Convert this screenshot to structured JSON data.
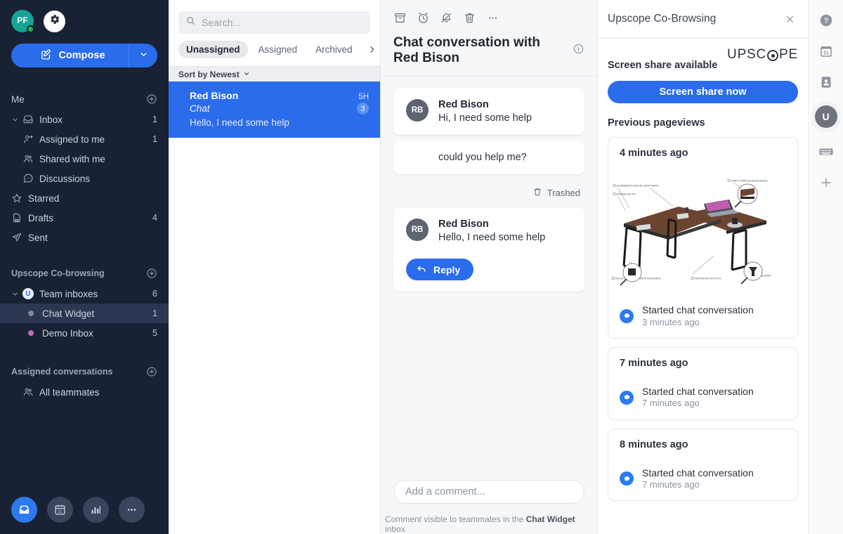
{
  "sidebar": {
    "me_avatar_initials": "PF",
    "compose_label": "Compose",
    "sections": [
      {
        "title": "Me"
      },
      {
        "title": "Upscope Co-browsing"
      },
      {
        "title": "Assigned conversations"
      }
    ],
    "me_items": [
      {
        "label": "Inbox",
        "count": "1",
        "icon": "inbox-icon"
      },
      {
        "label": "Assigned to me",
        "count": "1",
        "icon": "assigned-icon"
      },
      {
        "label": "Shared with me",
        "count": "",
        "icon": "shared-icon"
      },
      {
        "label": "Discussions",
        "count": "",
        "icon": "discussions-icon"
      },
      {
        "label": "Starred",
        "count": "",
        "icon": "star-icon"
      },
      {
        "label": "Drafts",
        "count": "4",
        "icon": "drafts-icon"
      },
      {
        "label": "Sent",
        "count": "",
        "icon": "sent-icon"
      }
    ],
    "team": {
      "label": "Team inboxes",
      "count": "6",
      "avatar_initial": "U",
      "children": [
        {
          "label": "Chat Widget",
          "count": "1",
          "dot_color": "#7d8796",
          "selected": true
        },
        {
          "label": "Demo Inbox",
          "count": "5",
          "dot_color": "#c06fba",
          "selected": false
        }
      ]
    },
    "assigned_items": [
      {
        "label": "All teammates",
        "count": "",
        "icon": "teammates-icon"
      }
    ],
    "dock": [
      {
        "name": "inbox-dock-icon",
        "active": true
      },
      {
        "name": "calendar-dock-icon",
        "active": false,
        "day": "31"
      },
      {
        "name": "analytics-dock-icon",
        "active": false
      },
      {
        "name": "more-dock-icon",
        "active": false
      }
    ]
  },
  "list": {
    "search_placeholder": "Search...",
    "search_value": "",
    "tabs": [
      {
        "label": "Unassigned",
        "active": true
      },
      {
        "label": "Assigned",
        "active": false
      },
      {
        "label": "Archived",
        "active": false
      }
    ],
    "sort_label": "Sort by Newest",
    "conversations": [
      {
        "name": "Red Bison",
        "time": "5H",
        "channel": "Chat",
        "unread_count": "3",
        "snippet": "Hello, I need some help"
      }
    ]
  },
  "conversation": {
    "toolbar": [
      {
        "name": "archive-icon"
      },
      {
        "name": "snooze-icon"
      },
      {
        "name": "mute-icon"
      },
      {
        "name": "trash-icon"
      },
      {
        "name": "more-icon"
      }
    ],
    "title": "Chat conversation with Red Bison",
    "messages": [
      {
        "avatar": "RB",
        "from": "Red Bison",
        "body": "Hi, I need some help",
        "show_head": true
      },
      {
        "avatar": "",
        "from": "",
        "body": "could you help me?",
        "show_head": false
      }
    ],
    "trashed_label": "Trashed",
    "last_message": {
      "avatar": "RB",
      "from": "Red Bison",
      "body": "Hello, I need some help"
    },
    "reply_label": "Reply",
    "composer_placeholder": "Add a comment...",
    "composer_value": "",
    "composer_note_prefix": "Comment visible to teammates in the ",
    "composer_note_inbox": "Chat Widget",
    "composer_note_suffix": " inbox"
  },
  "plugin": {
    "title": "Upscope Co-Browsing",
    "brand_before": "UPSC",
    "brand_after": "PE",
    "screen_share_status": "Screen share available",
    "screen_share_button": "Screen share now",
    "pageviews_title": "Previous pageviews",
    "pageviews": [
      {
        "when": "4 minutes ago",
        "has_thumb": true,
        "thumb_labels": [
          "ACABAMENTO MDF BP FACETINADO",
          "BORDAS EM PVC",
          "TAMPO 30MM ENGROSSURADO",
          "SOLDA COM ACABAMENTO SUAVIZADO",
          "PINTURA EM EPÓXI PÓ",
          "PÉ NIVELADOR"
        ],
        "event_title": "Started chat conversation",
        "event_time": "3 minutes ago"
      },
      {
        "when": "7 minutes ago",
        "has_thumb": false,
        "event_title": "Started chat conversation",
        "event_time": "7 minutes ago"
      },
      {
        "when": "8 minutes ago",
        "has_thumb": false,
        "event_title": "Started chat conversation",
        "event_time": "7 minutes ago"
      }
    ]
  },
  "rail": {
    "avatar_initial": "U",
    "items": [
      {
        "name": "help-icon"
      },
      {
        "name": "calendar-icon",
        "day": "31"
      },
      {
        "name": "contact-card-icon"
      },
      {
        "name": "keyboard-icon"
      },
      {
        "name": "add-plugin-icon"
      }
    ]
  },
  "colors": {
    "accent_blue": "#2b6cec",
    "sidebar_bg": "#182234",
    "selected_conv": "#2b6cec"
  }
}
